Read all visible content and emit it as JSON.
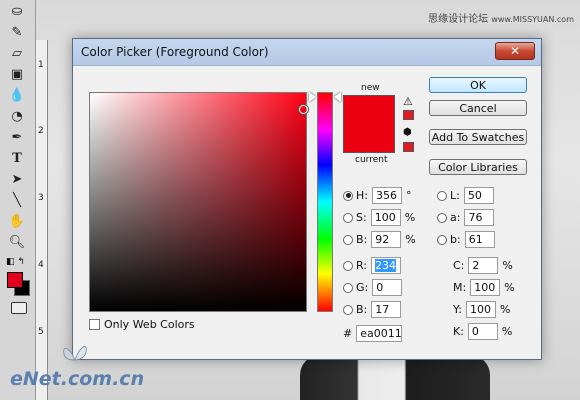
{
  "watermark": {
    "text": "思缘设计论坛",
    "site": "www.MISSYUAN.com"
  },
  "logo": {
    "text": "eNet.com.cn"
  },
  "ruler": {
    "marks": [
      "1",
      "2",
      "3",
      "4",
      "5"
    ]
  },
  "dialog": {
    "title": "Color Picker (Foreground Color)",
    "close_label": "✕",
    "preview": {
      "new_label": "new",
      "current_label": "current",
      "new_color": "#ea0011",
      "current_color": "#ea0011"
    },
    "buttons": {
      "ok": "OK",
      "cancel": "Cancel",
      "add_swatches": "Add To Swatches",
      "color_libraries": "Color Libraries"
    },
    "hsb": {
      "h": {
        "label": "H:",
        "value": "356",
        "unit": "°",
        "selected": true
      },
      "s": {
        "label": "S:",
        "value": "100",
        "unit": "%"
      },
      "b": {
        "label": "B:",
        "value": "92",
        "unit": "%"
      }
    },
    "rgb": {
      "r": {
        "label": "R:",
        "value": "234"
      },
      "g": {
        "label": "G:",
        "value": "0"
      },
      "b": {
        "label": "B:",
        "value": "17"
      }
    },
    "lab": {
      "l": {
        "label": "L:",
        "value": "50"
      },
      "a": {
        "label": "a:",
        "value": "76"
      },
      "b": {
        "label": "b:",
        "value": "61"
      }
    },
    "cmyk": {
      "c": {
        "label": "C:",
        "value": "2",
        "unit": "%"
      },
      "m": {
        "label": "M:",
        "value": "100",
        "unit": "%"
      },
      "y": {
        "label": "Y:",
        "value": "100",
        "unit": "%"
      },
      "k": {
        "label": "K:",
        "value": "0",
        "unit": "%"
      }
    },
    "hex": {
      "label": "#",
      "value": "ea0011"
    },
    "web_colors_label": "Only Web Colors"
  },
  "toolbox": {
    "foreground_color": "#e0001a",
    "background_color": "#000000"
  }
}
